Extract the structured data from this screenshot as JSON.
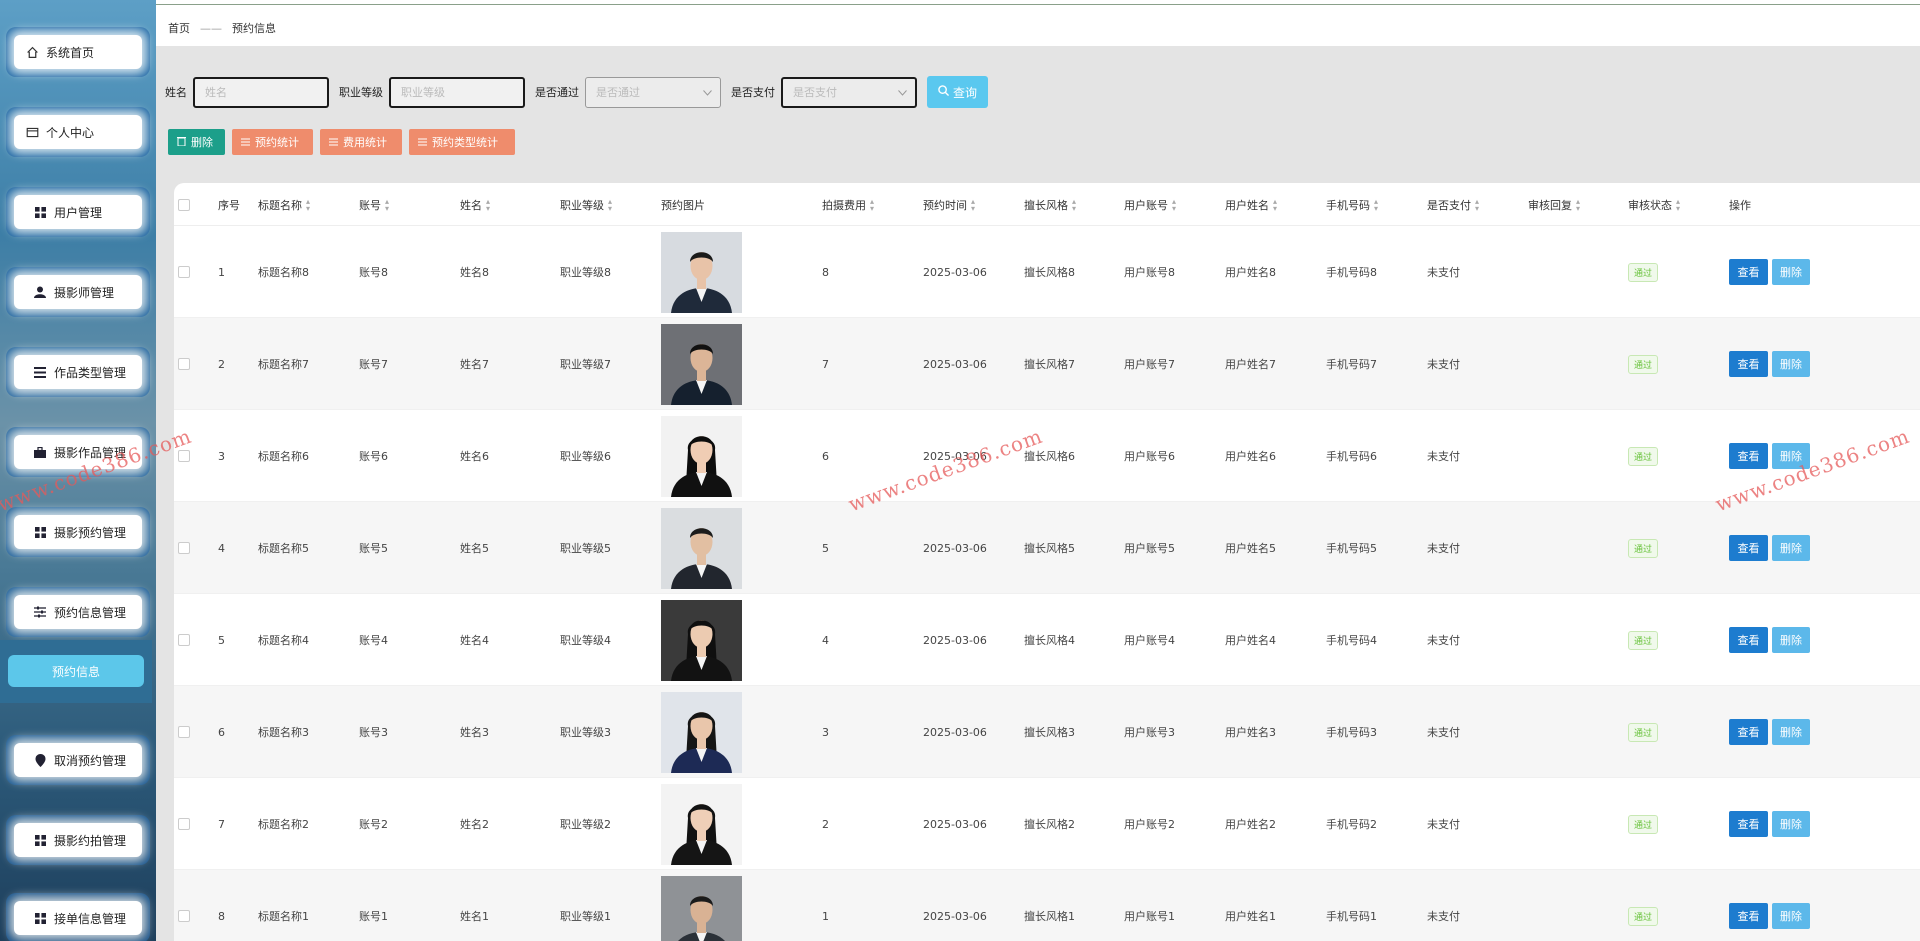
{
  "sidebar": {
    "items": [
      {
        "label": "系统首页",
        "icon": "home-icon"
      },
      {
        "label": "个人中心",
        "icon": "id-card-icon"
      },
      {
        "label": "用户管理",
        "icon": "grid-icon"
      },
      {
        "label": "摄影师管理",
        "icon": "user-icon"
      },
      {
        "label": "作品类型管理",
        "icon": "list-icon"
      },
      {
        "label": "摄影作品管理",
        "icon": "briefcase-icon"
      },
      {
        "label": "摄影预约管理",
        "icon": "grid-icon"
      },
      {
        "label": "预约信息管理",
        "icon": "sliders-icon"
      },
      {
        "label": "取消预约管理",
        "icon": "pin-icon"
      },
      {
        "label": "摄影约拍管理",
        "icon": "grid-icon"
      },
      {
        "label": "接单信息管理",
        "icon": "grid-icon"
      }
    ],
    "submenu_active": "预约信息"
  },
  "breadcrumb": {
    "home": "首页",
    "sep": "——",
    "current": "预约信息"
  },
  "search": {
    "name_label": "姓名",
    "name_placeholder": "姓名",
    "level_label": "职业等级",
    "level_placeholder": "职业等级",
    "pass_label": "是否通过",
    "pass_placeholder": "是否通过",
    "pay_label": "是否支付",
    "pay_placeholder": "是否支付",
    "query_button": "查询"
  },
  "actions": {
    "delete": "删除",
    "booking_stats": "预约统计",
    "fee_stats": "费用统计",
    "type_stats": "预约类型统计"
  },
  "table": {
    "headers": [
      "序号",
      "标题名称",
      "账号",
      "姓名",
      "职业等级",
      "预约图片",
      "拍摄费用",
      "预约时间",
      "擅长风格",
      "用户账号",
      "用户姓名",
      "手机号码",
      "是否支付",
      "审核回复",
      "审核状态",
      "操作"
    ],
    "view_label": "查看",
    "delete_label": "删除",
    "rows": [
      {
        "no": "1",
        "title": "标题名称8",
        "account": "账号8",
        "name": "姓名8",
        "level": "职业等级8",
        "fee": "8",
        "time": "2025-03-06",
        "style": "擅长风格8",
        "user_account": "用户账号8",
        "user_name": "用户姓名8",
        "phone": "手机号码8",
        "paid": "未支付",
        "reply": "",
        "status": "通过"
      },
      {
        "no": "2",
        "title": "标题名称7",
        "account": "账号7",
        "name": "姓名7",
        "level": "职业等级7",
        "fee": "7",
        "time": "2025-03-06",
        "style": "擅长风格7",
        "user_account": "用户账号7",
        "user_name": "用户姓名7",
        "phone": "手机号码7",
        "paid": "未支付",
        "reply": "",
        "status": "通过"
      },
      {
        "no": "3",
        "title": "标题名称6",
        "account": "账号6",
        "name": "姓名6",
        "level": "职业等级6",
        "fee": "6",
        "time": "2025-03-06",
        "style": "擅长风格6",
        "user_account": "用户账号6",
        "user_name": "用户姓名6",
        "phone": "手机号码6",
        "paid": "未支付",
        "reply": "",
        "status": "通过"
      },
      {
        "no": "4",
        "title": "标题名称5",
        "account": "账号5",
        "name": "姓名5",
        "level": "职业等级5",
        "fee": "5",
        "time": "2025-03-06",
        "style": "擅长风格5",
        "user_account": "用户账号5",
        "user_name": "用户姓名5",
        "phone": "手机号码5",
        "paid": "未支付",
        "reply": "",
        "status": "通过"
      },
      {
        "no": "5",
        "title": "标题名称4",
        "account": "账号4",
        "name": "姓名4",
        "level": "职业等级4",
        "fee": "4",
        "time": "2025-03-06",
        "style": "擅长风格4",
        "user_account": "用户账号4",
        "user_name": "用户姓名4",
        "phone": "手机号码4",
        "paid": "未支付",
        "reply": "",
        "status": "通过"
      },
      {
        "no": "6",
        "title": "标题名称3",
        "account": "账号3",
        "name": "姓名3",
        "level": "职业等级3",
        "fee": "3",
        "time": "2025-03-06",
        "style": "擅长风格3",
        "user_account": "用户账号3",
        "user_name": "用户姓名3",
        "phone": "手机号码3",
        "paid": "未支付",
        "reply": "",
        "status": "通过"
      },
      {
        "no": "7",
        "title": "标题名称2",
        "account": "账号2",
        "name": "姓名2",
        "level": "职业等级2",
        "fee": "2",
        "time": "2025-03-06",
        "style": "擅长风格2",
        "user_account": "用户账号2",
        "user_name": "用户姓名2",
        "phone": "手机号码2",
        "paid": "未支付",
        "reply": "",
        "status": "通过"
      },
      {
        "no": "8",
        "title": "标题名称1",
        "account": "账号1",
        "name": "姓名1",
        "level": "职业等级1",
        "fee": "1",
        "time": "2025-03-06",
        "style": "擅长风格1",
        "user_account": "用户账号1",
        "user_name": "用户姓名1",
        "phone": "手机号码1",
        "paid": "未支付",
        "reply": "",
        "status": "通过"
      }
    ]
  },
  "watermark": "www.code386.com",
  "colors": {
    "primary": "#1d7ccf",
    "query": "#5ac8ef",
    "delete": "#1c9f8a",
    "stat": "#ef8c6c",
    "pass": "#67c23a",
    "watermark": "#e65a5a"
  }
}
